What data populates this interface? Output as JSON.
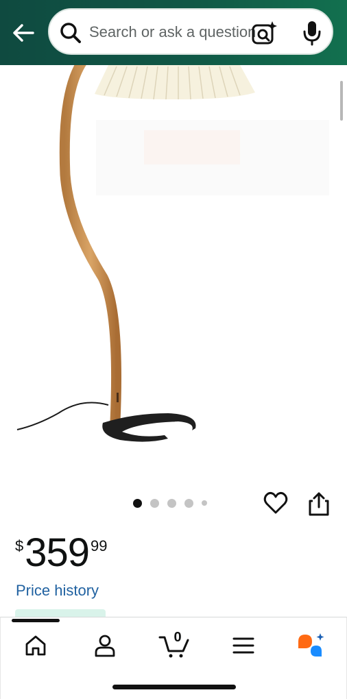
{
  "search": {
    "placeholder": "Search or ask a question"
  },
  "carousel": {
    "total_dots": 5,
    "active_index": 0
  },
  "price": {
    "currency": "$",
    "whole": "359",
    "fraction": "99"
  },
  "links": {
    "price_history": "Price history"
  },
  "bottom_nav": {
    "cart_count": "0",
    "items": [
      "home-icon",
      "account-icon",
      "cart-icon",
      "menu-icon",
      "rufus-icon"
    ]
  },
  "colors": {
    "header_start": "#0f4a40",
    "header_end": "#12704f",
    "link": "#2162a1",
    "rufus_orange": "#ff6a13",
    "rufus_blue": "#1a8cff"
  }
}
